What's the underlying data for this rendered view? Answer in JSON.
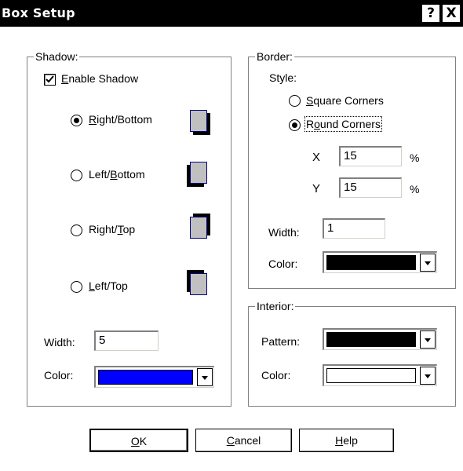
{
  "window": {
    "title": "Box Setup",
    "help_btn": "?",
    "close_btn": "X"
  },
  "shadow": {
    "label": "Shadow:",
    "enable": {
      "checked": true,
      "underline": "E",
      "rest": "nable Shadow"
    },
    "positions": [
      {
        "pre": "",
        "u": "R",
        "post": "ight/Bottom",
        "selected": true
      },
      {
        "pre": "Left/",
        "u": "B",
        "post": "ottom",
        "selected": false
      },
      {
        "pre": "Right/",
        "u": "T",
        "post": "op",
        "selected": false
      },
      {
        "pre": "",
        "u": "L",
        "post": "eft/Top",
        "selected": false
      }
    ],
    "width_label": "Width:",
    "width_value": "5",
    "color_label": "Color:",
    "color_value": "#0000ff"
  },
  "border": {
    "label": "Border:",
    "style_label": "Style:",
    "square": {
      "u": "S",
      "post": "quare Corners",
      "selected": false
    },
    "round": {
      "pre": "R",
      "u": "o",
      "post": "und Corners",
      "selected": true
    },
    "x_label": "X",
    "x_value": "15",
    "y_label": "Y",
    "y_value": "15",
    "percent": "%",
    "width_label": "Width:",
    "width_value": "1",
    "color_label": "Color:",
    "color_value": "#000000"
  },
  "interior": {
    "label": "Interior:",
    "pattern_label": "Pattern:",
    "pattern_value": "#000000",
    "color_label": "Color:",
    "color_value": "#ffffff"
  },
  "buttons": {
    "ok": {
      "u": "O",
      "post": "K"
    },
    "cancel": {
      "u": "C",
      "post": "ancel"
    },
    "help": {
      "u": "H",
      "post": "elp"
    }
  }
}
